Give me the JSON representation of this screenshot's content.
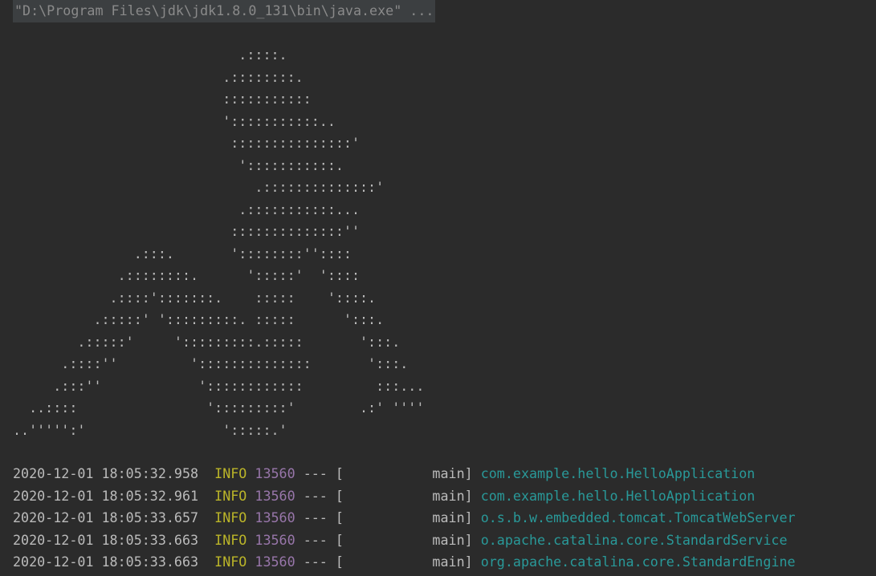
{
  "console": {
    "command": "\"D:\\Program Files\\jdk\\jdk1.8.0_131\\bin\\java.exe\" ...",
    "banner_lines": [
      "                            .::::.",
      "                          .::::::::.",
      "                          :::::::::::",
      "                          ':::::::::::..",
      "                           :::::::::::::::'",
      "                            ':::::::::::.",
      "                              .::::::::::::::'",
      "                            .:::::::::::...",
      "                           ::::::::::::::''",
      "               .:::.       '::::::::''::::",
      "             .::::::::.      ':::::'  '::::",
      "            .::::':::::::.    :::::    '::::.",
      "          .:::::' ':::::::::. :::::      ':::.",
      "        .:::::'     ':::::::::.:::::       ':::.",
      "      .::::''         '::::::::::::::       ':::.",
      "     .:::''            '::::::::::::         :::...",
      "  ..::::                ':::::::::'        .:' ''''",
      "..''''':'                 ':::::.'"
    ],
    "logs": [
      {
        "timestamp": "2020-12-01 18:05:32.958",
        "level": " INFO",
        "pid": "13560",
        "separator": "---",
        "thread": "[           main]",
        "logger": "com.example.hello.HelloApplication"
      },
      {
        "timestamp": "2020-12-01 18:05:32.961",
        "level": " INFO",
        "pid": "13560",
        "separator": "---",
        "thread": "[           main]",
        "logger": "com.example.hello.HelloApplication"
      },
      {
        "timestamp": "2020-12-01 18:05:33.657",
        "level": " INFO",
        "pid": "13560",
        "separator": "---",
        "thread": "[           main]",
        "logger": "o.s.b.w.embedded.tomcat.TomcatWebServer"
      },
      {
        "timestamp": "2020-12-01 18:05:33.663",
        "level": " INFO",
        "pid": "13560",
        "separator": "---",
        "thread": "[           main]",
        "logger": "o.apache.catalina.core.StandardService"
      },
      {
        "timestamp": "2020-12-01 18:05:33.663",
        "level": " INFO",
        "pid": "13560",
        "separator": "---",
        "thread": "[           main]",
        "logger": "org.apache.catalina.core.StandardEngine"
      }
    ]
  },
  "colors": {
    "background": "#2b2b2b",
    "text": "#bbbbbb",
    "command_background": "#3c3f41",
    "command_text": "#8a8a8a",
    "level": "#bbb529",
    "pid": "#9876aa",
    "logger": "#299999"
  }
}
